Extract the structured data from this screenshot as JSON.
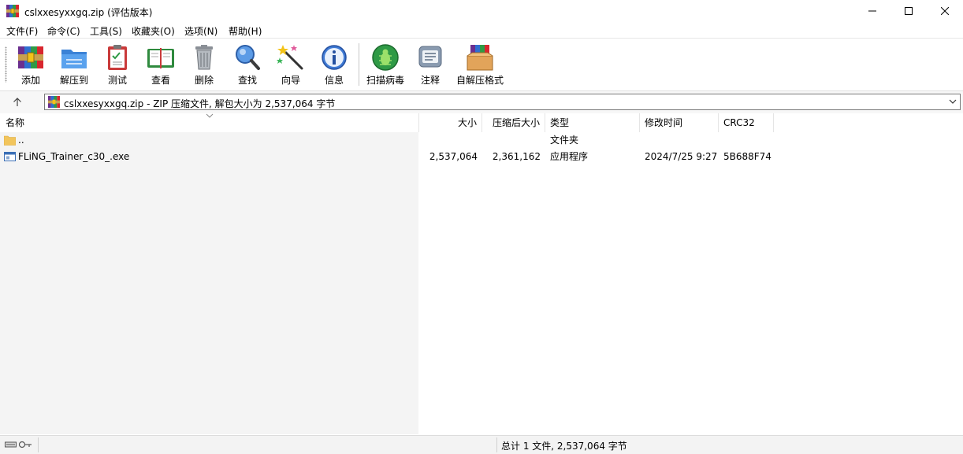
{
  "window": {
    "title": "cslxxesyxxgq.zip (评估版本)",
    "accent_colors": {
      "rar_purple": "#6b2f8f",
      "rar_red": "#d8262e",
      "rar_yellow": "#f3c318",
      "rar_green": "#2f9a46",
      "rar_blue": "#2f6fd0"
    }
  },
  "menu": [
    "文件(F)",
    "命令(C)",
    "工具(S)",
    "收藏夹(O)",
    "选项(N)",
    "帮助(H)"
  ],
  "toolbar": {
    "add": {
      "label": "添加",
      "icon": "add-archive-icon"
    },
    "extract": {
      "label": "解压到",
      "icon": "extract-folder-icon"
    },
    "test": {
      "label": "测试",
      "icon": "test-clipboard-icon"
    },
    "view": {
      "label": "查看",
      "icon": "book-icon"
    },
    "delete": {
      "label": "删除",
      "icon": "trash-icon"
    },
    "find": {
      "label": "查找",
      "icon": "magnifier-icon"
    },
    "wizard": {
      "label": "向导",
      "icon": "magic-wand-icon"
    },
    "info": {
      "label": "信息",
      "icon": "info-icon"
    },
    "virus": {
      "label": "扫描病毒",
      "icon": "bug-scan-icon"
    },
    "comment": {
      "label": "注释",
      "icon": "comment-note-icon"
    },
    "sfx": {
      "label": "自解压格式",
      "icon": "sfx-box-icon"
    }
  },
  "address": {
    "text": "cslxxesyxxgq.zip - ZIP 压缩文件, 解包大小为 2,537,064 字节"
  },
  "columns": {
    "name": "名称",
    "size": "大小",
    "packed": "压缩后大小",
    "type": "类型",
    "modified": "修改时间",
    "crc": "CRC32"
  },
  "files": [
    {
      "name": "..",
      "size": "",
      "packed": "",
      "type": "文件夹",
      "modified": "",
      "crc": "",
      "icon": "folder-icon"
    },
    {
      "name": "FLiNG_Trainer_c30_.exe",
      "size": "2,537,064",
      "packed": "2,361,162",
      "type": "应用程序",
      "modified": "2024/7/25 9:27",
      "crc": "5B688F74",
      "icon": "exe-file-icon"
    }
  ],
  "status": {
    "text": "总计 1 文件, 2,537,064 字节"
  }
}
